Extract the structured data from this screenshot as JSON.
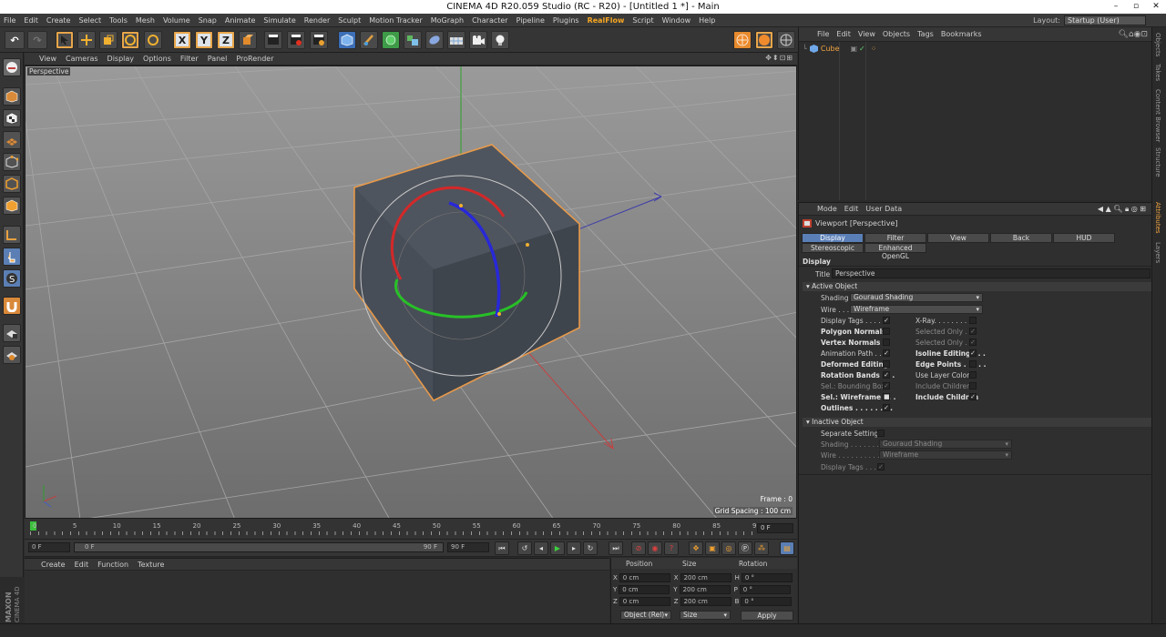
{
  "window": {
    "title": "CINEMA 4D R20.059 Studio (RC - R20) - [Untitled 1 *] - Main",
    "min": "–",
    "max": "▫",
    "close": "✕"
  },
  "menubar": [
    "File",
    "Edit",
    "Create",
    "Select",
    "Tools",
    "Mesh",
    "Volume",
    "Snap",
    "Animate",
    "Simulate",
    "Render",
    "Sculpt",
    "Motion Tracker",
    "MoGraph",
    "Character",
    "Pipeline",
    "Plugins",
    "RealFlow",
    "Script",
    "Window",
    "Help"
  ],
  "highlight_menu": "RealFlow",
  "layout": {
    "label": "Layout:",
    "value": "Startup (User)"
  },
  "toolbar": {
    "undo_glyph": "↶",
    "redo_glyph": "↷",
    "x_label": "X",
    "y_label": "Y",
    "z_label": "Z"
  },
  "viewport": {
    "menu": [
      "View",
      "Cameras",
      "Display",
      "Options",
      "Filter",
      "Panel",
      "ProRender"
    ],
    "navi": "✥⬍⊡⊞",
    "label": "Perspective",
    "frame": "Frame : 0",
    "grid": "Grid Spacing : 100 cm"
  },
  "timeline": {
    "ticks": [
      "0",
      "5",
      "10",
      "15",
      "20",
      "25",
      "30",
      "35",
      "40",
      "45",
      "50",
      "55",
      "60",
      "65",
      "70",
      "75",
      "80",
      "85",
      "90"
    ],
    "current": "0 F"
  },
  "playback": {
    "start": "0 F",
    "range_start": "0 F",
    "range_end": "90 F",
    "end": "90 F"
  },
  "material": {
    "menu": [
      "Create",
      "Edit",
      "Function",
      "Texture"
    ]
  },
  "coords": {
    "headers": [
      "Position",
      "Size",
      "Rotation"
    ],
    "rows": [
      {
        "a": "X",
        "pos": "0 cm",
        "s": "X",
        "size": "200 cm",
        "r": "H",
        "rot": "0 °"
      },
      {
        "a": "Y",
        "pos": "0 cm",
        "s": "Y",
        "size": "200 cm",
        "r": "P",
        "rot": "0 °"
      },
      {
        "a": "Z",
        "pos": "0 cm",
        "s": "Z",
        "size": "200 cm",
        "r": "B",
        "rot": "0 °"
      }
    ],
    "mode": "Object (Rel)",
    "size_mode": "Size",
    "apply": "Apply"
  },
  "objects": {
    "menu": [
      "File",
      "Edit",
      "View",
      "Objects",
      "Tags",
      "Bookmarks"
    ],
    "item": "Cube"
  },
  "sidetabs": [
    "Objects",
    "Takes",
    "Content Browser",
    "Structure",
    "Attributes",
    "Layers"
  ],
  "attributes": {
    "menu": [
      "Mode",
      "Edit",
      "User Data"
    ],
    "name": "Viewport [Perspective]",
    "tabs": [
      "Display",
      "Filter",
      "View",
      "Back",
      "HUD",
      "Stereoscopic",
      "Enhanced OpenGL"
    ],
    "section": "Display",
    "title_label": "Title",
    "title_value": "Perspective",
    "active": "Active Object",
    "shading_label": "Shading",
    "shading": "Gouraud Shading",
    "wire_label": "Wire . . .",
    "wire": "Wireframe",
    "left": [
      {
        "l": "Display Tags . . . . .",
        "c": "✓"
      },
      {
        "l": "Polygon Normals",
        "c": ""
      },
      {
        "l": "Vertex Normals",
        "c": ""
      },
      {
        "l": "Animation Path . . .",
        "c": "✓"
      },
      {
        "l": "Deformed Editing",
        "c": ""
      },
      {
        "l": "Rotation Bands . . .",
        "c": "✓"
      },
      {
        "l": "Sel.: Bounding Box",
        "c": "✓"
      },
      {
        "l": "Sel.: Wireframe . . .",
        "c": "■"
      },
      {
        "l": "Outlines . . . . . . . .",
        "c": "✓"
      }
    ],
    "right": [
      {
        "l": "X-Ray. . . . . . . . . .",
        "c": ""
      },
      {
        "l": "Selected Only . . .",
        "c": "✓"
      },
      {
        "l": "Selected Only . . .",
        "c": "✓"
      },
      {
        "l": "Isoline Editing . . .",
        "c": "✓"
      },
      {
        "l": "Edge Points . . . . .",
        "c": ""
      },
      {
        "l": "Use Layer Color",
        "c": ""
      },
      {
        "l": "Include Children",
        "c": ""
      },
      {
        "l": "Include Children",
        "c": "✓"
      }
    ],
    "inactive": "Inactive Object",
    "sep_label": "Separate Settings",
    "ishading_label": "Shading . . . . . . . .",
    "ishading": "Gouraud Shading",
    "iwire_label": "Wire . . . . . . . . . . .",
    "iwire": "Wireframe",
    "itags_label": "Display Tags . . . .",
    "itags": "✓"
  },
  "maxon": {
    "brand": "MAXON",
    "product": "CINEMA 4D"
  }
}
